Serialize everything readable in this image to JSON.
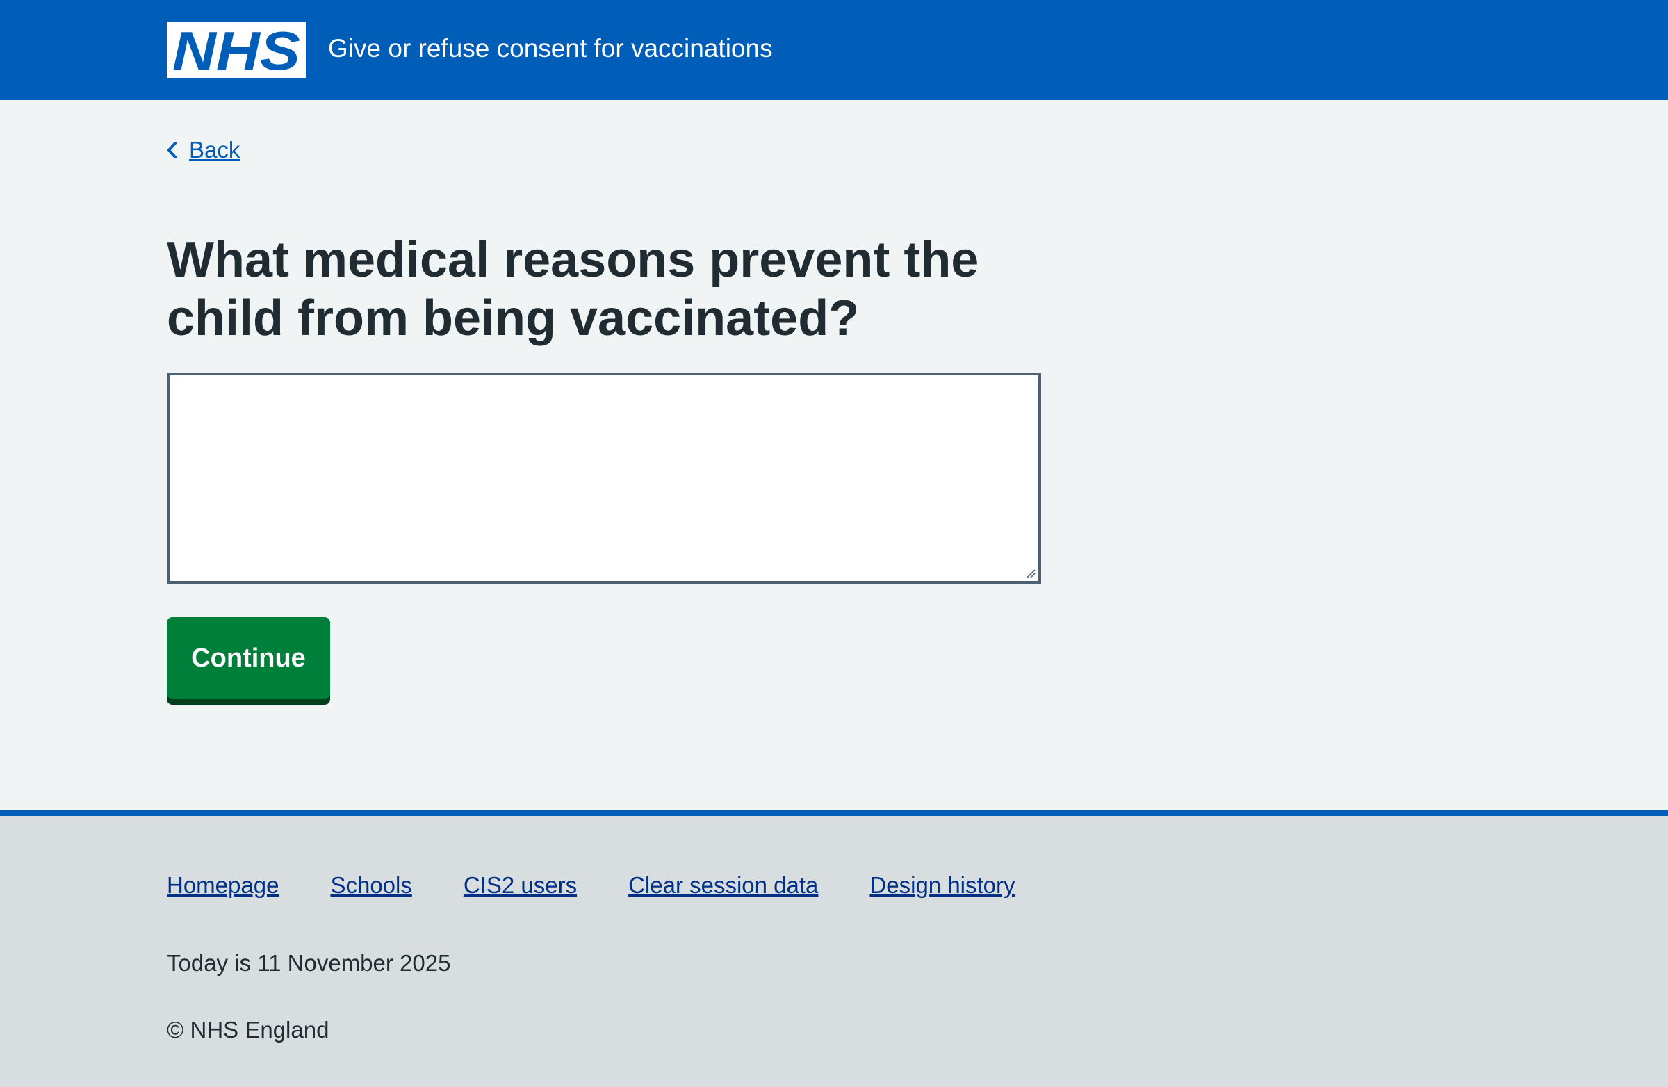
{
  "header": {
    "logo_text": "NHS",
    "service_name": "Give or refuse consent for vaccinations",
    "brand_color": "#005eb8"
  },
  "back_link": {
    "label": "Back",
    "icon": "chevron-left-icon"
  },
  "main": {
    "title": "What medical reasons prevent the child from being vaccinated?",
    "textarea_value": "",
    "continue_label": "Continue",
    "button_color": "#007f3b"
  },
  "footer": {
    "links": [
      "Homepage",
      "Schools",
      "CIS2 users",
      "Clear session data",
      "Design history"
    ],
    "date_text": "Today is 11 November 2025",
    "copyright": "© NHS England"
  }
}
